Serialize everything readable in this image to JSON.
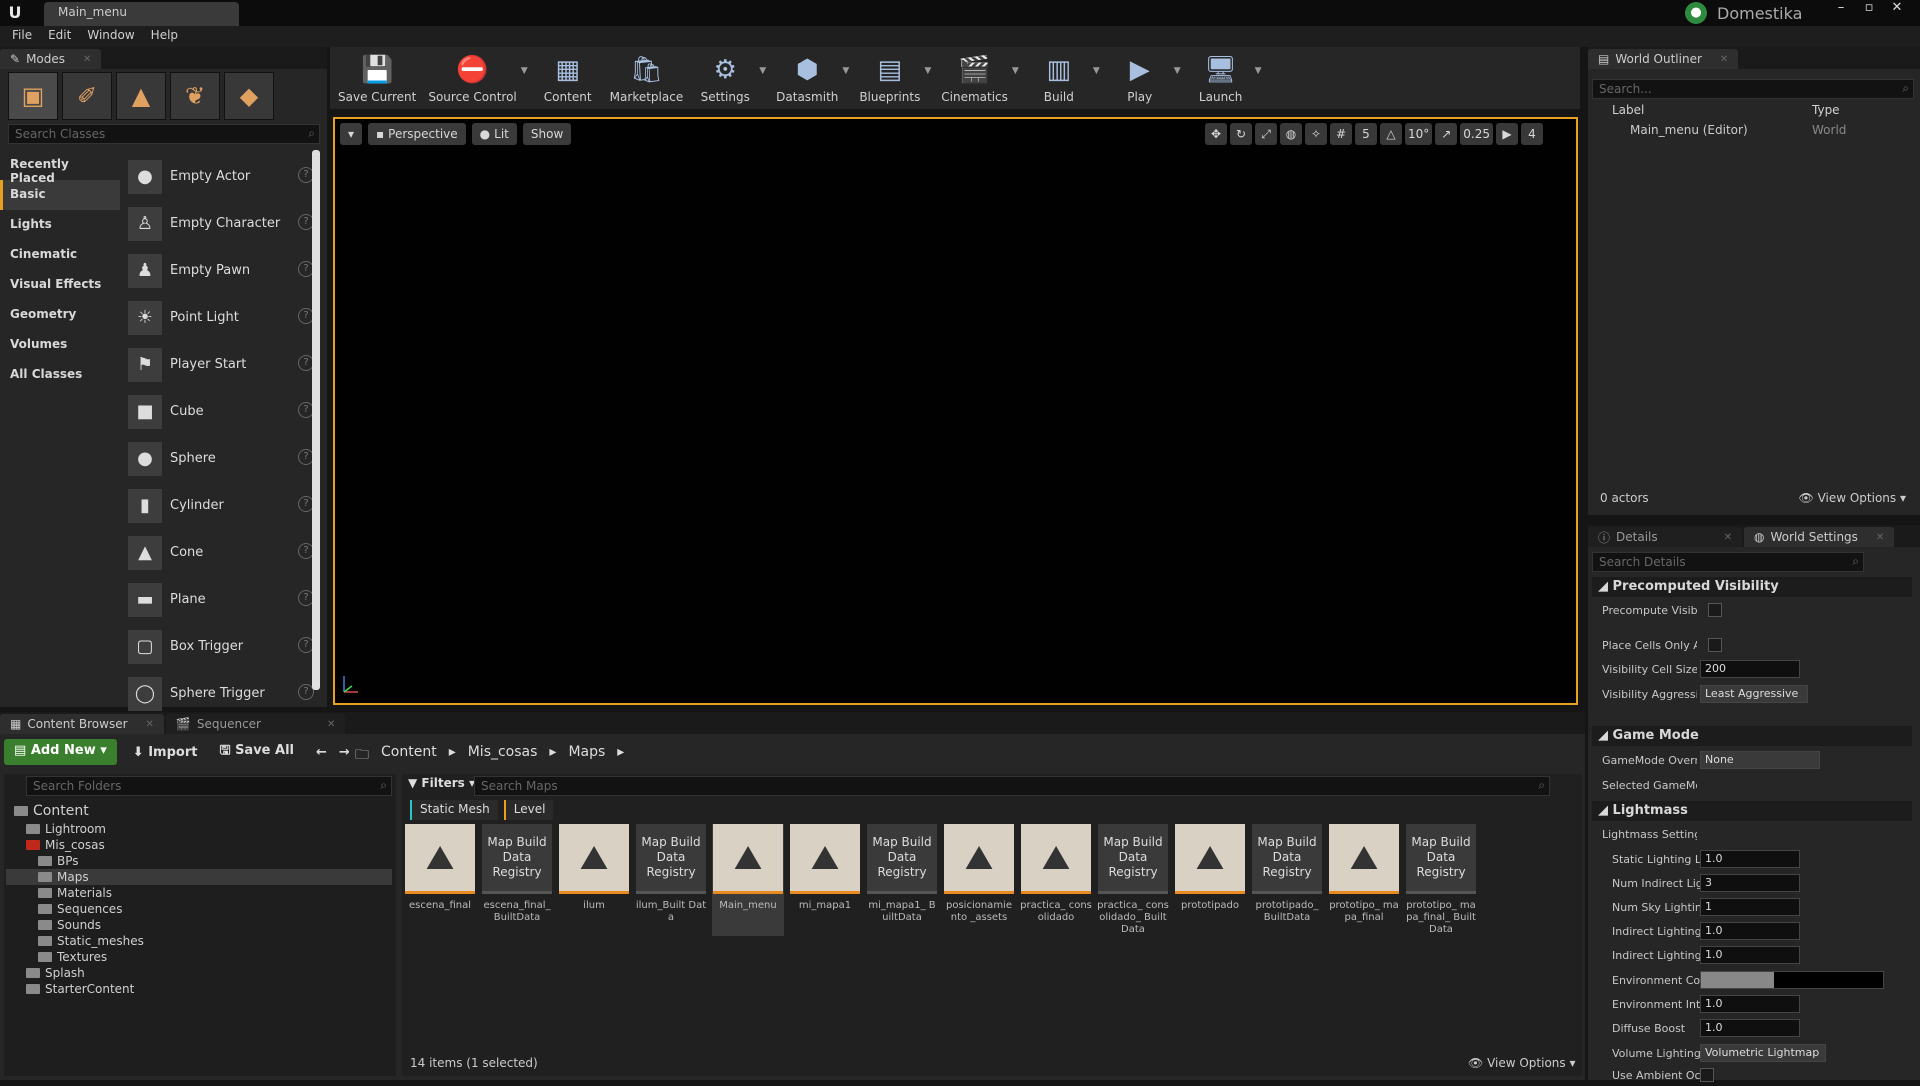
{
  "window": {
    "tab": "Main_menu",
    "brand": "Domestika"
  },
  "menu": [
    "File",
    "Edit",
    "Window",
    "Help"
  ],
  "modes": {
    "tab": "Modes",
    "search_placeholder": "Search Classes",
    "categories": [
      "Recently Placed",
      "Basic",
      "Lights",
      "Cinematic",
      "Visual Effects",
      "Geometry",
      "Volumes",
      "All Classes"
    ],
    "selected_category": "Basic",
    "classes": [
      "Empty Actor",
      "Empty Character",
      "Empty Pawn",
      "Point Light",
      "Player Start",
      "Cube",
      "Sphere",
      "Cylinder",
      "Cone",
      "Plane",
      "Box Trigger",
      "Sphere Trigger"
    ]
  },
  "toolbar": [
    "Save Current",
    "Source Control",
    "Content",
    "Marketplace",
    "Settings",
    "Datasmith",
    "Blueprints",
    "Cinematics",
    "Build",
    "Play",
    "Launch"
  ],
  "viewport": {
    "perspective": "Perspective",
    "lit": "Lit",
    "show": "Show",
    "grid": "5",
    "angle": "10°",
    "scale": "0.25",
    "camera": "4"
  },
  "outliner": {
    "tab": "World Outliner",
    "search_placeholder": "Search...",
    "col_label": "Label",
    "col_type": "Type",
    "row_label": "Main_menu (Editor)",
    "row_type": "World",
    "actors": "0 actors",
    "view_options": "View Options"
  },
  "details": {
    "tab1": "Details",
    "tab2": "World Settings",
    "search_placeholder": "Search Details",
    "sec_precomputed": "Precomputed Visibility",
    "precompute": "Precompute Visibil",
    "place_cells": "Place Cells Only Al",
    "cell_size_label": "Visibility Cell Size",
    "cell_size": "200",
    "aggr_label": "Visibility Aggressiv",
    "aggr": "Least Aggressive",
    "sec_gamemode": "Game Mode",
    "gm_override_label": "GameMode Overri",
    "gm_override": "None",
    "selected_gm": "Selected GameMc",
    "sec_lightmass": "Lightmass",
    "lm_settings": "Lightmass Setting:",
    "static_label": "Static Lighting Le",
    "static_val": "1.0",
    "num_indirect_label": "Num Indirect Lig",
    "num_indirect": "3",
    "num_sky_label": "Num Sky Lightin",
    "num_sky": "1",
    "ind1_label": "Indirect Lighting",
    "ind1": "1.0",
    "ind2_label": "Indirect Lighting",
    "ind2": "1.0",
    "env_col_label": "Environment Col",
    "env_int_label": "Environment Inte",
    "env_int": "1.0",
    "diffuse_label": "Diffuse Boost",
    "diffuse": "1.0",
    "vol_label": "Volume Lighting",
    "vol": "Volumetric Lightmap",
    "ambient_label": "Use Ambient Occ"
  },
  "content_browser": {
    "tab1": "Content Browser",
    "tab2": "Sequencer",
    "add_new": "Add New",
    "import": "Import",
    "save_all": "Save All",
    "breadcrumb": [
      "Content",
      "Mis_cosas",
      "Maps"
    ],
    "folder_search": "Search Folders",
    "filters": "Filters",
    "asset_search": "Search Maps",
    "chips": [
      "Static Mesh",
      "Level"
    ],
    "folders": [
      "Content",
      "Lightroom",
      "Mis_cosas",
      "BPs",
      "Maps",
      "Materials",
      "Sequences",
      "Sounds",
      "Static_meshes",
      "Textures",
      "Splash",
      "StarterContent"
    ],
    "assets": [
      {
        "name": "escena_final",
        "kind": "map"
      },
      {
        "name": "escena_final_ BuiltData",
        "kind": "reg"
      },
      {
        "name": "ilum",
        "kind": "map"
      },
      {
        "name": "ilum_Built Data",
        "kind": "reg"
      },
      {
        "name": "Main_menu",
        "kind": "map"
      },
      {
        "name": "mi_mapa1",
        "kind": "map"
      },
      {
        "name": "mi_mapa1_ BuiltData",
        "kind": "reg"
      },
      {
        "name": "posicionamiento _assets",
        "kind": "map"
      },
      {
        "name": "practica_ consolidado",
        "kind": "map"
      },
      {
        "name": "practica_ consolidado_ BuiltData",
        "kind": "reg"
      },
      {
        "name": "prototipado",
        "kind": "map"
      },
      {
        "name": "prototipado_ BuiltData",
        "kind": "reg"
      },
      {
        "name": "prototipo_ mapa_final",
        "kind": "map"
      },
      {
        "name": "prototipo_ mapa_final_ BuiltData",
        "kind": "reg"
      }
    ],
    "registry_label": "Map Build Data Registry",
    "count": "14 items (1 selected)",
    "view_options": "View Options"
  }
}
